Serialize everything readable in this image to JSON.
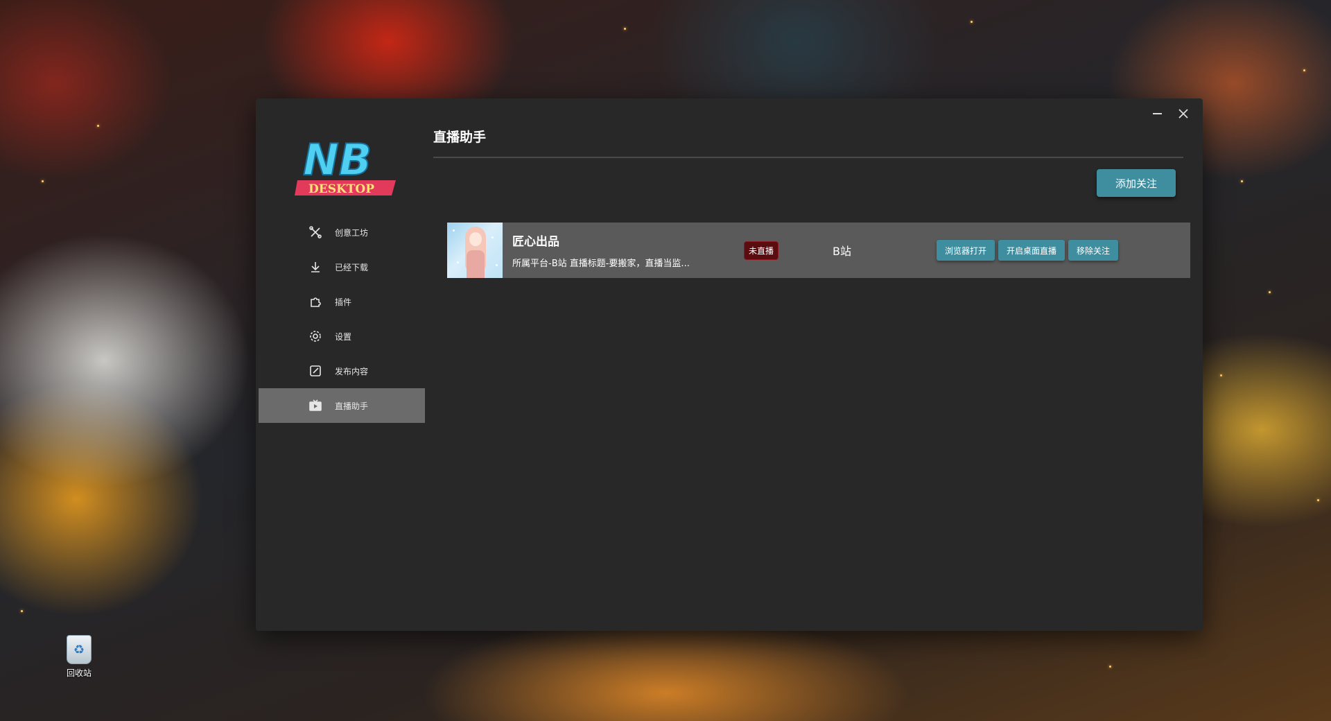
{
  "desktop": {
    "recycle_bin_label": "回收站"
  },
  "window": {
    "minimize_icon": "minimize-icon",
    "close_icon": "close-icon"
  },
  "logo": {
    "line1": "NB",
    "line2": "DESKTOP"
  },
  "sidebar": {
    "items": [
      {
        "label": "创意工坊",
        "icon": "tools-icon"
      },
      {
        "label": "已经下载",
        "icon": "download-icon"
      },
      {
        "label": "插件",
        "icon": "puzzle-icon"
      },
      {
        "label": "设置",
        "icon": "gear-icon"
      },
      {
        "label": "发布内容",
        "icon": "edit-icon"
      },
      {
        "label": "直播助手",
        "icon": "tv-icon",
        "active": true
      }
    ]
  },
  "main": {
    "title": "直播助手",
    "add_button": "添加关注",
    "streams": [
      {
        "name": "匠心出品",
        "details": "所属平台-B站 直播标题-要搬家，直播当监...",
        "status": "未直播",
        "platform": "B站",
        "actions": [
          "浏览器打开",
          "开启桌面直播",
          "移除关注"
        ]
      }
    ]
  },
  "colors": {
    "window_bg": "#282828",
    "accent": "#3e8ea0",
    "row_bg": "#5a5a5a",
    "active_nav_bg": "#6b6b6b",
    "status_bg": "#5a0d10"
  }
}
